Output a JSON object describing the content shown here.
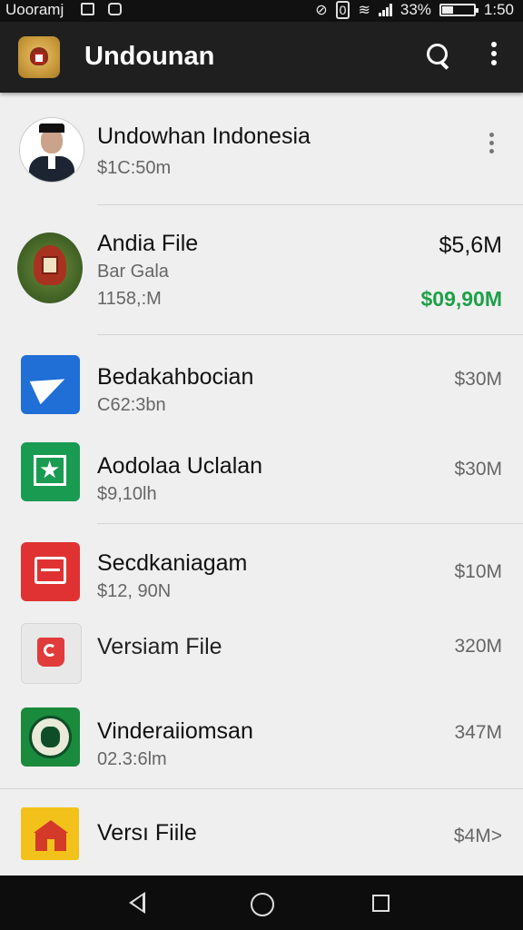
{
  "status_bar": {
    "carrier": "Uooramj",
    "battery": "33%",
    "time": "1:50"
  },
  "app_bar": {
    "title": "Undounan"
  },
  "list": [
    {
      "title": "Undowhan Indonesia",
      "subtitle": "$1C:50m",
      "icon": "person-avatar"
    },
    {
      "title": "Andia File",
      "subtitle": "Bar Gala",
      "subtitle2": "1158,:M",
      "size": "$5,6M",
      "size2": "$09,90M",
      "icon": "garuda-emblem"
    },
    {
      "title": "Bedakahbocian",
      "subtitle": "C62:3bn",
      "size": "$30M",
      "icon": "paper-plane-icon"
    },
    {
      "title": "Aodolaa Uclalan",
      "subtitle": "$9,10lh",
      "size": "$30M",
      "icon": "star-frame-icon"
    },
    {
      "title": "Secdkaniagam",
      "subtitle": "$12, 90N",
      "size": "$10M",
      "icon": "red-box-icon"
    },
    {
      "title": "Versiam File",
      "size": "320M",
      "icon": "red-document-icon"
    },
    {
      "title": "Vinderaiiomsan",
      "subtitle": "02.3:6lm",
      "size": "347M",
      "icon": "green-seal-icon"
    },
    {
      "title": "Versı Fiile",
      "size": "$4M>",
      "icon": "house-icon"
    }
  ],
  "colors": {
    "app_bar": "#1f1f1f",
    "accent_green": "#1ea04a",
    "background": "#efefef"
  }
}
